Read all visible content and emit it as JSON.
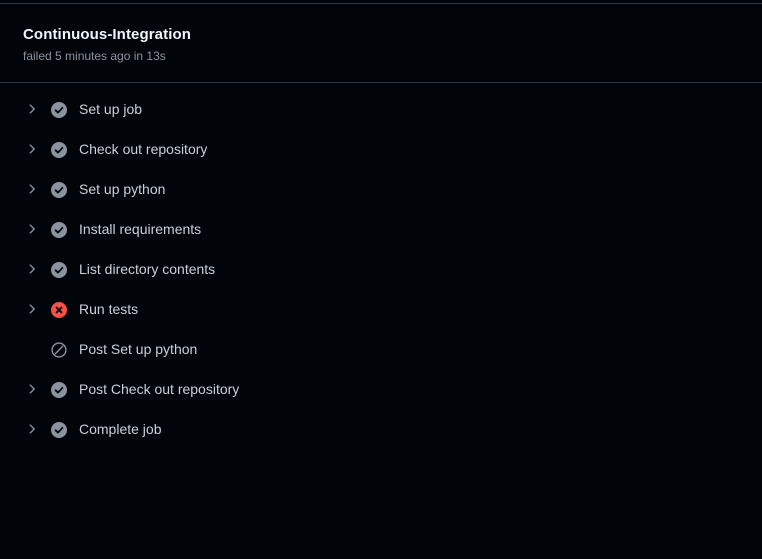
{
  "job": {
    "title": "Continuous-Integration",
    "subtitle": "failed 5 minutes ago in 13s"
  },
  "steps": [
    {
      "label": "Set up job",
      "status": "success",
      "expandable": true
    },
    {
      "label": "Check out repository",
      "status": "success",
      "expandable": true
    },
    {
      "label": "Set up python",
      "status": "success",
      "expandable": true
    },
    {
      "label": "Install requirements",
      "status": "success",
      "expandable": true
    },
    {
      "label": "List directory contents",
      "status": "success",
      "expandable": true
    },
    {
      "label": "Run tests",
      "status": "failure",
      "expandable": true
    },
    {
      "label": "Post Set up python",
      "status": "skipped",
      "expandable": false
    },
    {
      "label": "Post Check out repository",
      "status": "success",
      "expandable": true
    },
    {
      "label": "Complete job",
      "status": "success",
      "expandable": true
    }
  ],
  "icons": {
    "expand": "chevron-right-icon",
    "success": "check-circle-fill-icon",
    "failure": "x-circle-fill-icon",
    "skipped": "skip-icon"
  },
  "colors": {
    "background": "#010409",
    "success_icon": "#8b949e",
    "failure_icon": "#f85149",
    "text": "#c9d1d9",
    "muted": "#8b949e"
  }
}
